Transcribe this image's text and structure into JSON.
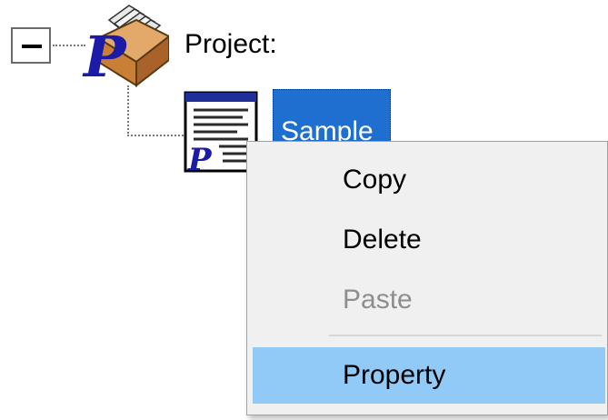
{
  "tree": {
    "root": {
      "expanded": true,
      "expander_icon": "minus-box-icon",
      "icon": "project-folder-icon",
      "label": "Project:"
    },
    "children": [
      {
        "icon": "document-p-icon",
        "label": "Sample",
        "selected": true
      }
    ]
  },
  "context_menu": {
    "items": [
      {
        "label": "Copy",
        "enabled": true
      },
      {
        "label": "Delete",
        "enabled": true
      },
      {
        "label": "Paste",
        "enabled": false
      },
      {
        "separator": true
      },
      {
        "label": "Property",
        "enabled": true,
        "highlighted": true
      }
    ]
  },
  "colors": {
    "selection": "#1f6fd0",
    "menu_background": "#f0f0f0",
    "menu_highlight": "#91c9f7",
    "disabled_text": "#8e8e8e"
  }
}
